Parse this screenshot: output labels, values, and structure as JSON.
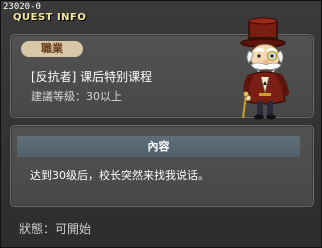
{
  "window": {
    "quest_id": "23020-0",
    "title": "QUEST INFO"
  },
  "quest": {
    "job_badge": "職業",
    "name": "[反抗者] 课后特别课程",
    "level_requirement": "建議等級：30以上"
  },
  "content": {
    "header": "內容",
    "text": "达到30级后，校长突然来找我说话。"
  },
  "status": {
    "text": "狀態：可開始"
  },
  "npc": {
    "icon": "npc-principal-portrait"
  },
  "colors": {
    "title_yellow": "#f4e79a",
    "badge_bg": "#d8c7a8",
    "badge_text": "#6a3e1f",
    "header_bg": "#5f6f78"
  }
}
